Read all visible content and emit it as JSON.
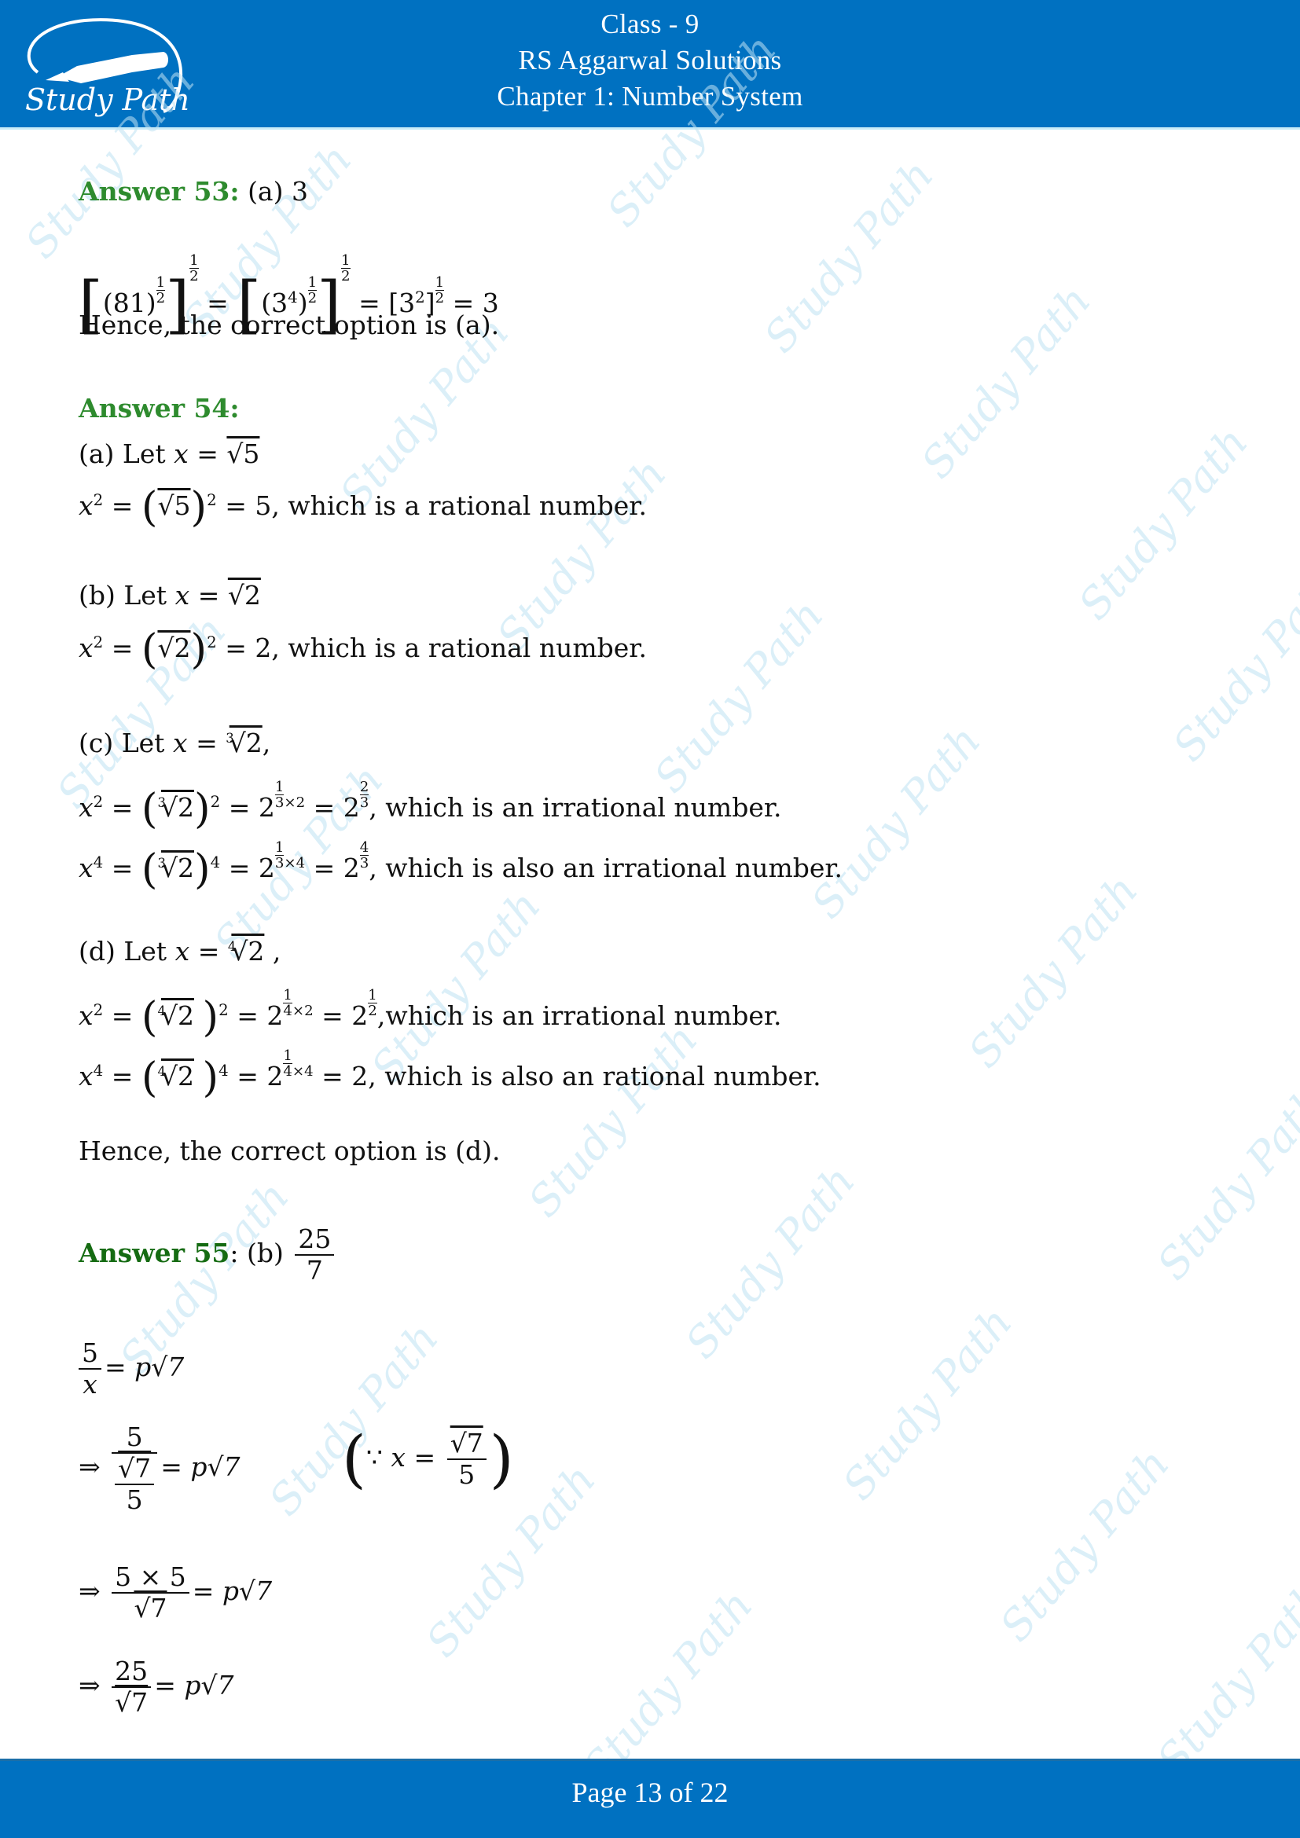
{
  "header": {
    "logo_text": "Study Path",
    "line1": "Class - 9",
    "line2": "RS Aggarwal Solutions",
    "line3": "Chapter 1: Number System"
  },
  "watermark_text": "Study Path",
  "answers": [
    {
      "label": "Answer 53:",
      "choice": "(a) 3",
      "expr": {
        "b1_base": "(81)",
        "half_num": "1",
        "half_den": "2",
        "eq": "=",
        "b2_base": "(3",
        "b2_exp": "4",
        "b2_close": ")",
        "b3": "[3",
        "b3_exp": "2",
        "b3_close": "]",
        "result": "3"
      },
      "conclusion": "Hence, the correct option is (a)."
    },
    {
      "label": "Answer 54:",
      "parts": [
        {
          "let": "(a) Let",
          "var": "x",
          "eq": "=",
          "val": "√5",
          "sq_lhs": "x",
          "sq_exp": "2",
          "sq_inner": "√5",
          "sq_res": "= 5, which is a rational number."
        },
        {
          "let": "(b) Let",
          "var": "x",
          "eq": "=",
          "val": "√2",
          "sq_lhs": "x",
          "sq_exp": "2",
          "sq_inner": "√2",
          "sq_res": "= 2, which is a rational number."
        },
        {
          "let": "(c) Let",
          "var": "x",
          "eq": "=",
          "root_index": "3",
          "val": "√2",
          "suffix": ",",
          "line2_lhs": "x",
          "line2_exp": "2",
          "line2_pow": "2",
          "line2_step_num": "1",
          "line2_step_den": "3",
          "line2_step_mult": "×2",
          "line2_res_num": "2",
          "line2_res_den": "3",
          "line2_text": ", which is an irrational number.",
          "line3_lhs": "x",
          "line3_exp": "4",
          "line3_pow": "4",
          "line3_step_num": "1",
          "line3_step_den": "3",
          "line3_step_mult": "×4",
          "line3_res_num": "4",
          "line3_res_den": "3",
          "line3_text": ", which is also an irrational number."
        },
        {
          "let": "(d) Let",
          "var": "x",
          "eq": "=",
          "root_index": "4",
          "val": "√2",
          "suffix": " ,",
          "line2_lhs": "x",
          "line2_exp": "2",
          "line2_pow": "2",
          "line2_step_num": "1",
          "line2_step_den": "4",
          "line2_step_mult": "×2",
          "line2_res_num": "1",
          "line2_res_den": "2",
          "line2_text": ",which is an irrational number.",
          "line3_lhs": "x",
          "line3_exp": "4",
          "line3_pow": "4",
          "line3_step_num": "1",
          "line3_step_den": "4",
          "line3_step_mult": "×4",
          "line3_res": "= 2,",
          "line3_text": " which is also an rational number."
        }
      ],
      "conclusion": "Hence, the correct option is (d)."
    },
    {
      "label": "Answer 55",
      "colon": ":",
      "choice": "(b)",
      "choice_num": "25",
      "choice_den": "7",
      "steps": {
        "s1_num": "5",
        "s1_den": "x",
        "rhs": "= p√7",
        "implies": "⇒",
        "s2_num": "5",
        "s2_den_num": "√7",
        "s2_den_den": "5",
        "note_because": "∵",
        "note_var": "x",
        "note_eq": "=",
        "note_num": "√7",
        "note_den": "5",
        "s3_num": "5 × 5",
        "s3_den": "√7",
        "s4_num": "25",
        "s4_den": "√7"
      }
    }
  ],
  "footer": {
    "page_label": "Page 13 of 22",
    "current_page": 13,
    "total_pages": 22
  },
  "colors": {
    "header_bg": "#0071c1",
    "answer_label": "#2e8b2e",
    "answer55_label": "#156b12",
    "watermark": "#bfe3f4"
  }
}
